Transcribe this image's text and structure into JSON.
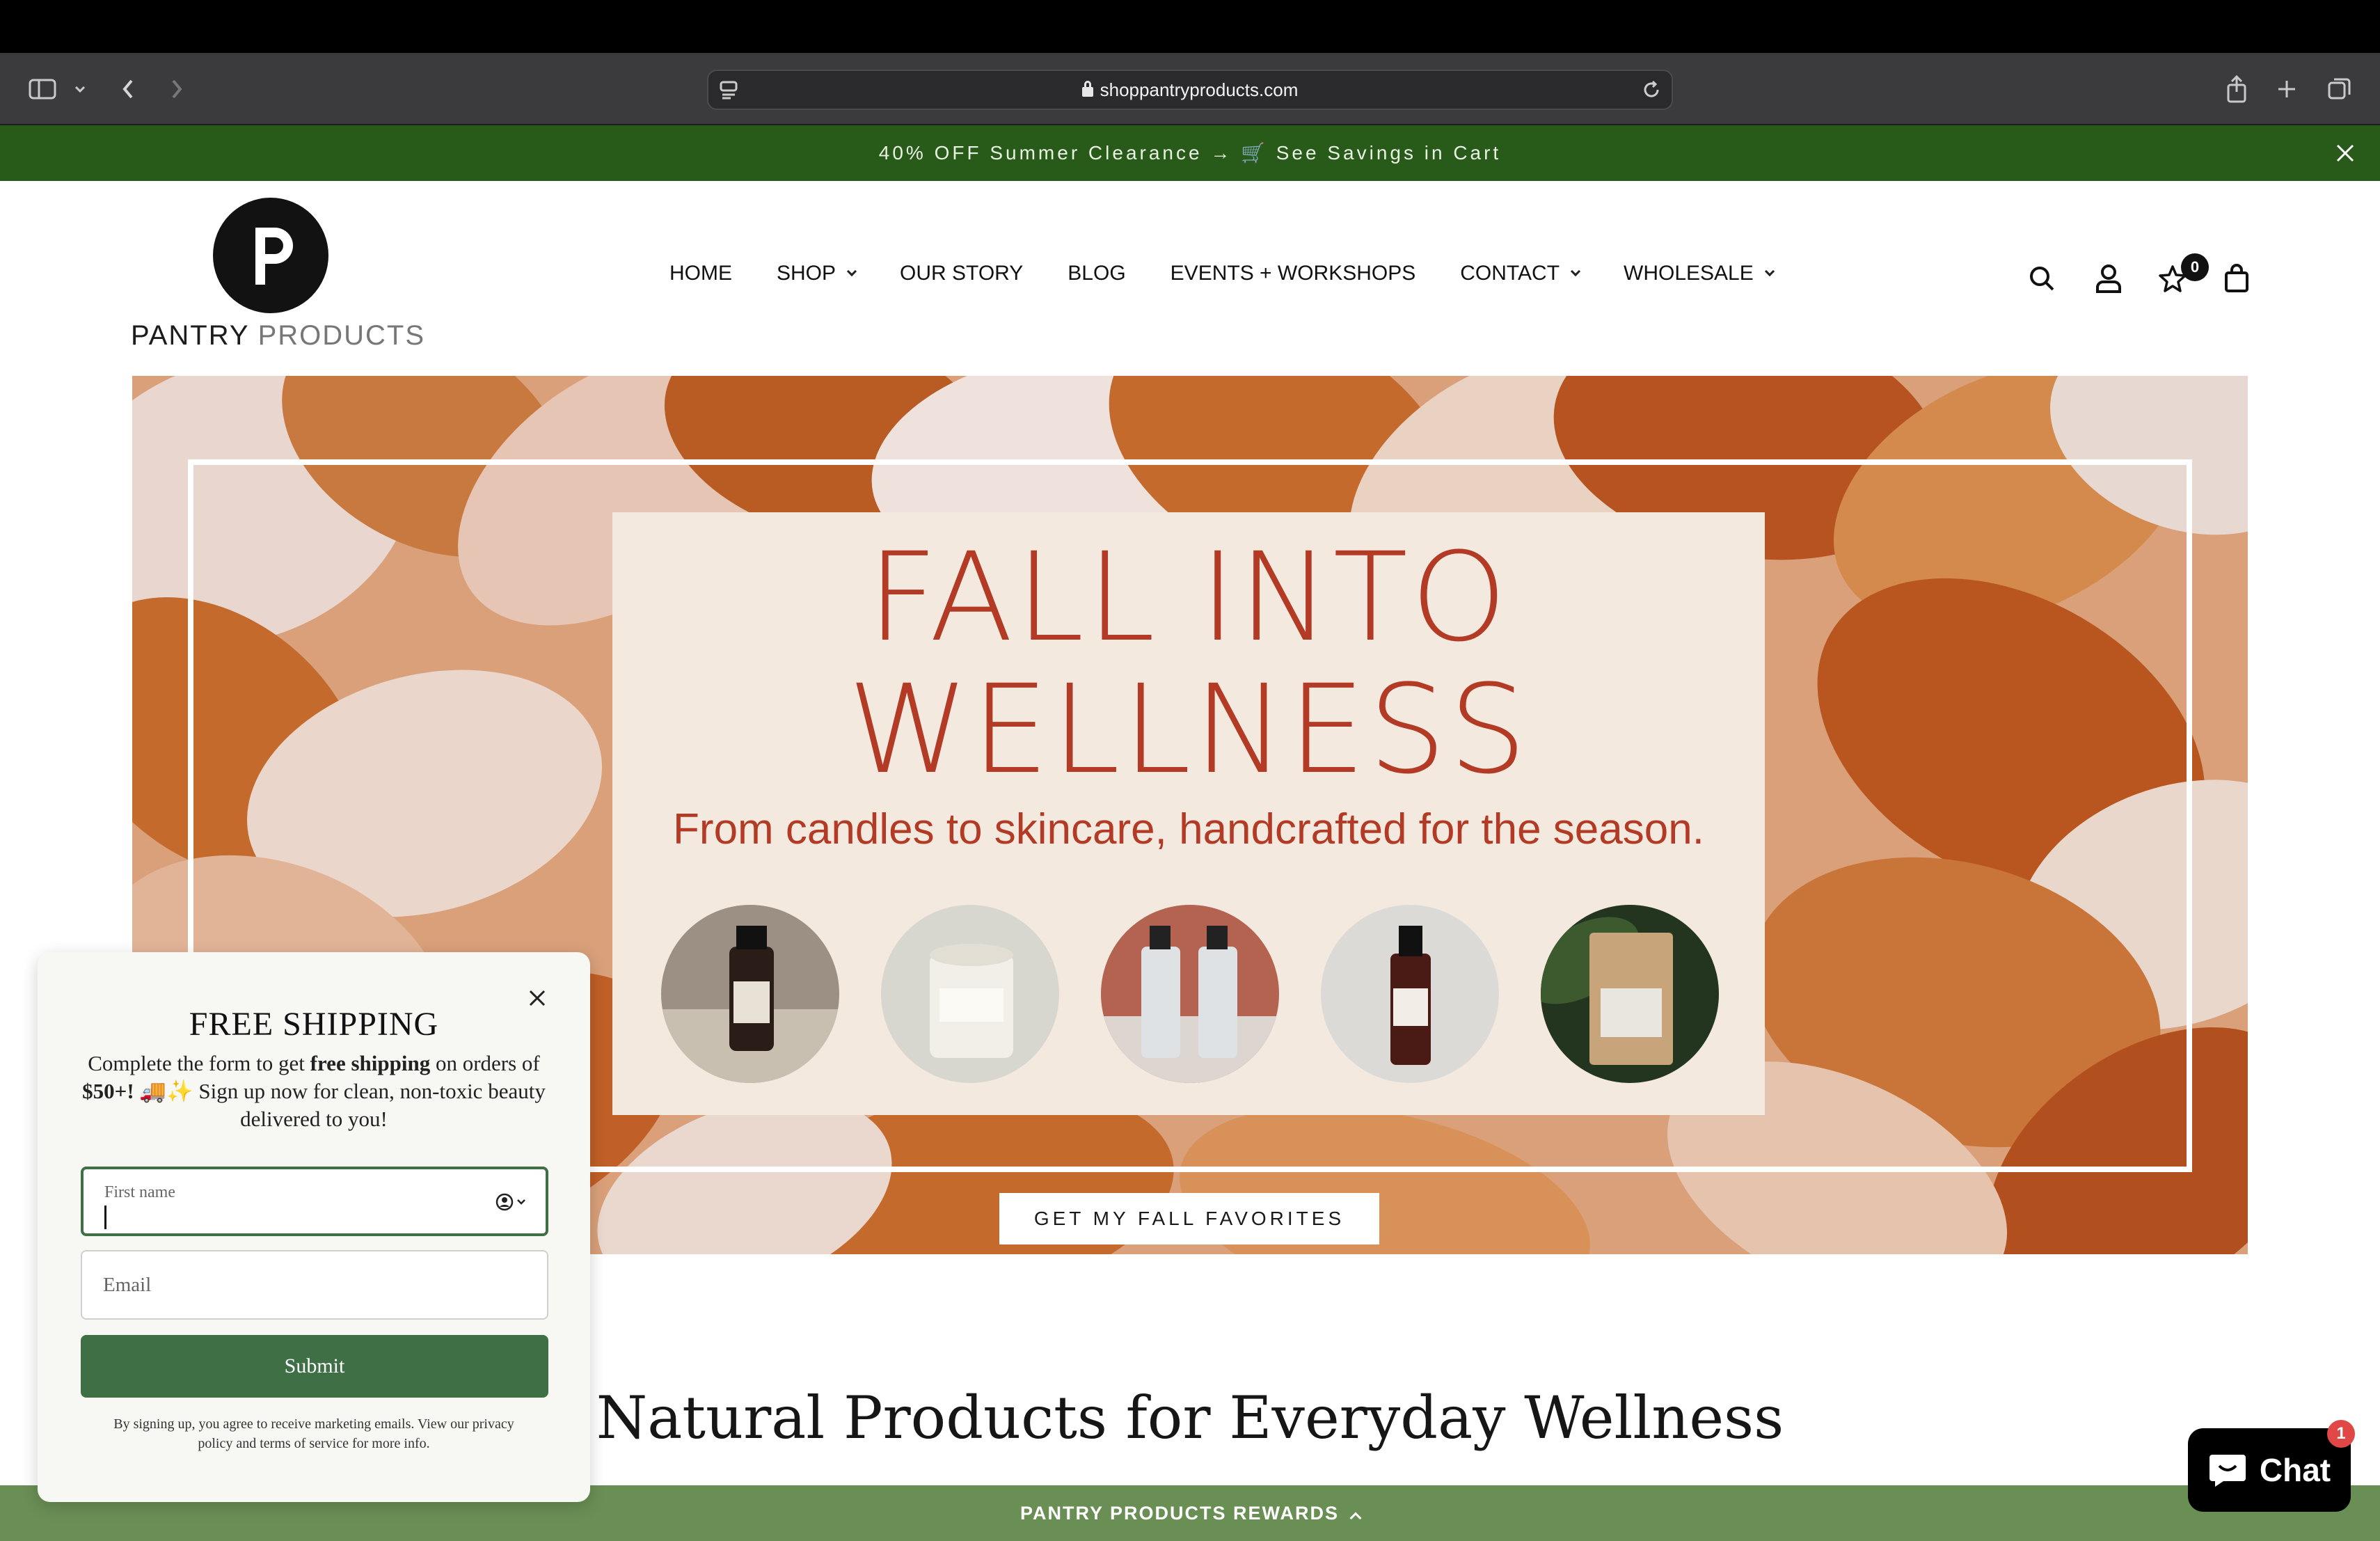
{
  "browser": {
    "url": "shoppantryproducts.com"
  },
  "announcement": {
    "text": "40% OFF Summer Clearance → 🛒 See Savings in Cart"
  },
  "header": {
    "logo_word1": "PANTRY",
    "logo_word2": "PRODUCTS",
    "nav": [
      {
        "label": "HOME"
      },
      {
        "label": "SHOP"
      },
      {
        "label": "OUR STORY"
      },
      {
        "label": "BLOG"
      },
      {
        "label": "EVENTS + WORKSHOPS"
      },
      {
        "label": "CONTACT"
      },
      {
        "label": "WHOLESALE"
      }
    ],
    "wishlist_count": "0"
  },
  "hero": {
    "title": "FALL INTO\nWELLNESS",
    "subtitle": "From candles to skincare, handcrafted for the season.",
    "cta": "GET MY FALL FAVORITES"
  },
  "section": {
    "title": "Natural Products for Everyday Wellness"
  },
  "popup": {
    "title": "FREE SHIPPING",
    "body_1": "Complete the form to get ",
    "body_bold_1": "free shipping",
    "body_2": " on orders of ",
    "body_bold_2": "$50+!",
    "body_3": " 🚚✨ Sign up now for clean, non-toxic beauty delivered to you!",
    "first_name_label": "First name",
    "email_placeholder": "Email",
    "submit": "Submit",
    "legal": "By signing up, you agree to receive marketing emails. View our privacy policy and terms of service for more info."
  },
  "rewards": {
    "label": "PANTRY PRODUCTS REWARDS"
  },
  "chat": {
    "label": "Chat",
    "badge": "1"
  },
  "colors": {
    "announce_bg": "#285a1a",
    "hero_text": "#b33b26",
    "popup_accent": "#3f6f44",
    "rewards_bg": "#6a8f55"
  }
}
